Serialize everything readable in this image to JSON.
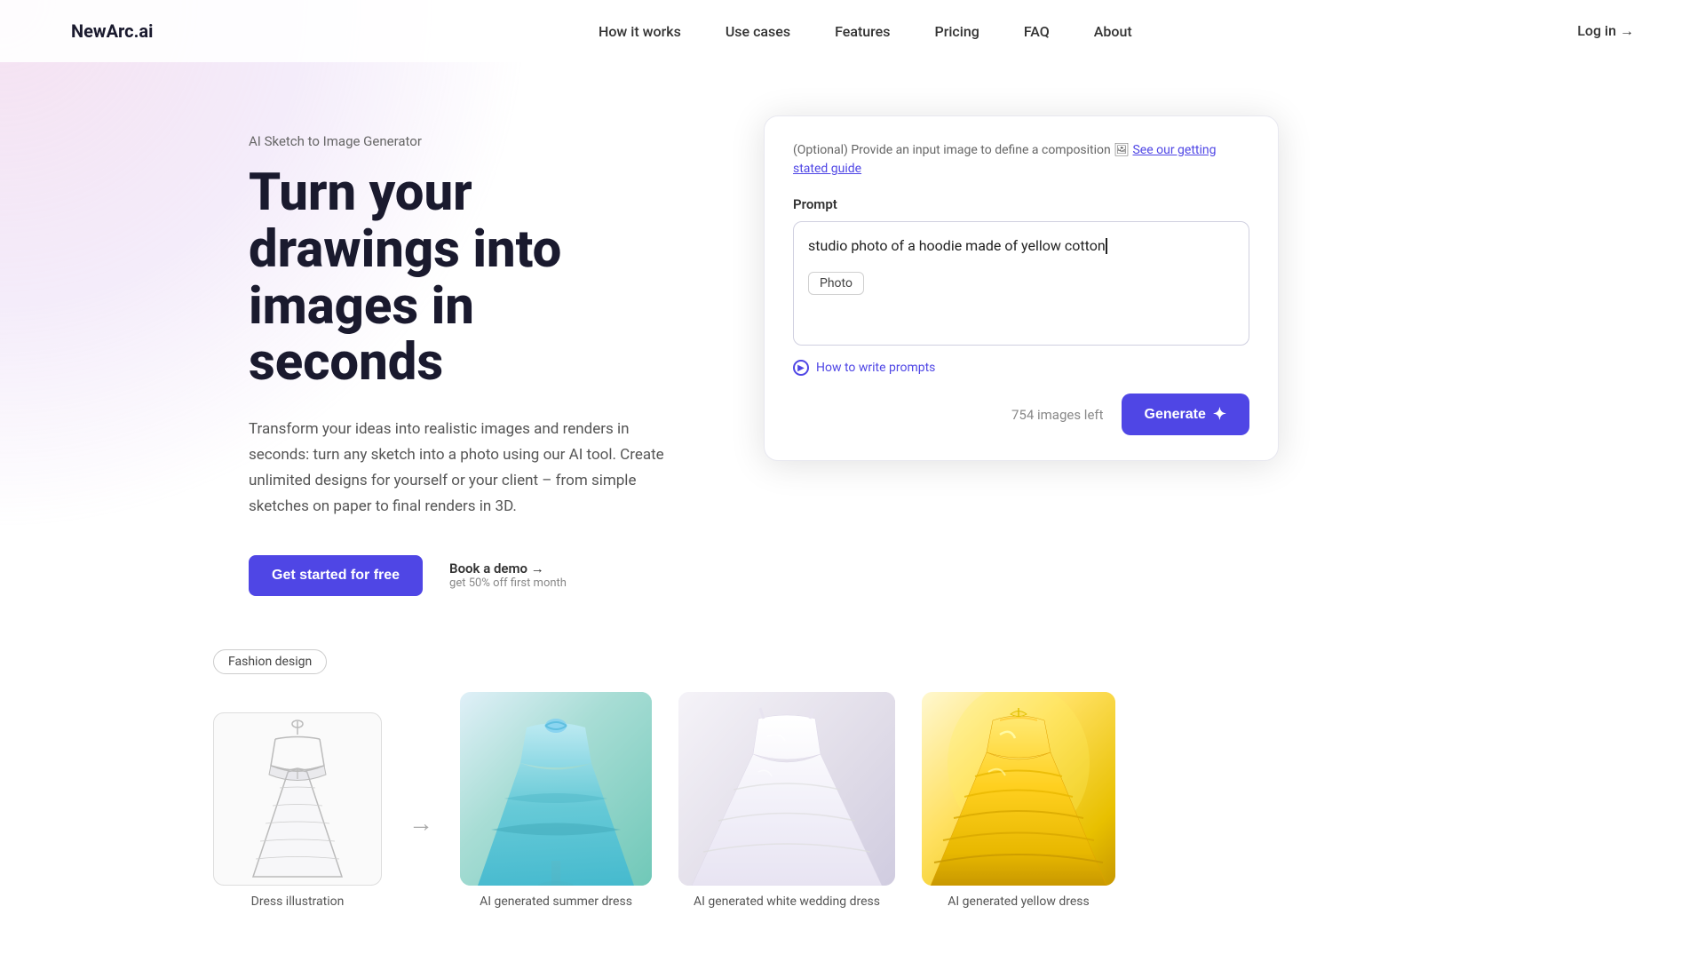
{
  "brand": "NewArc.ai",
  "nav": {
    "links": [
      {
        "id": "how-it-works",
        "label": "How it works"
      },
      {
        "id": "use-cases",
        "label": "Use cases"
      },
      {
        "id": "features",
        "label": "Features"
      },
      {
        "id": "pricing",
        "label": "Pricing"
      },
      {
        "id": "faq",
        "label": "FAQ"
      },
      {
        "id": "about",
        "label": "About"
      }
    ],
    "login": "Log in →"
  },
  "hero": {
    "subtitle": "AI Sketch to Image Generator",
    "title": "Turn your drawings into images in seconds",
    "description": "Transform your ideas into realistic images and renders in seconds: turn any sketch into a photo using our AI tool. Create unlimited designs for yourself or your client – from simple sketches on paper to final renders in 3D.",
    "cta_primary": "Get started for free",
    "book_demo": "Book a demo →",
    "book_demo_sub": "get 50% off first month"
  },
  "widget": {
    "optional_text": "(Optional) Provide an input image to define a composition 🖼",
    "guide_link_label": "See our getting stated guide",
    "prompt_label": "Prompt",
    "prompt_text": "studio photo of a hoodie made of yellow cotton",
    "tag": "Photo",
    "hint": "How to write prompts",
    "images_left": "754 images left",
    "generate_label": "Generate"
  },
  "gallery": {
    "badge": "Fashion design",
    "items": [
      {
        "id": "sketch",
        "label": "Dress illustration"
      },
      {
        "id": "summer",
        "label": "AI generated summer dress"
      },
      {
        "id": "wedding",
        "label": "AI generated white wedding dress"
      },
      {
        "id": "yellow",
        "label": "AI generated yellow dress"
      }
    ]
  }
}
